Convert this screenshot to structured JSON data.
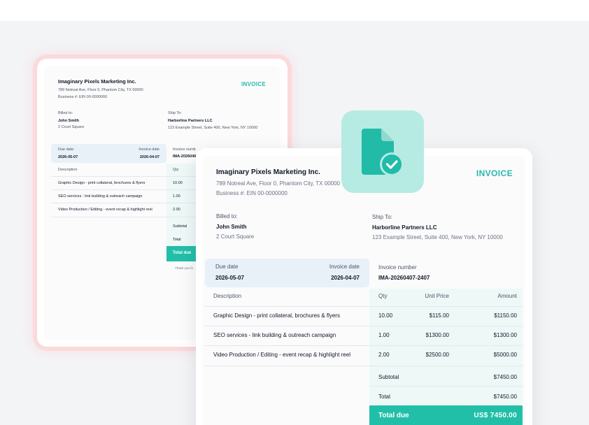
{
  "back_invoice": {
    "company": "Imaginary Pixels Marketing Inc.",
    "address": "789 Notreal Ave, Floor 0, Phantom City, TX 00000",
    "business_number": "Business #: EIN 00-0000000",
    "title": "INVOICE",
    "billed_to_label": "Billed to:",
    "billed_to_name": "John Smith",
    "billed_to_address": "2 Court Square",
    "ship_to_label": "Ship To:",
    "ship_to_name": "Harborline Partners LLC",
    "ship_to_address": "123 Example Street, Suite 400, New York, NY 10000",
    "due_date_label": "Due date",
    "due_date": "2026-05-07",
    "invoice_date_label": "Invoice date",
    "invoice_date": "2026-04-07",
    "invoice_number_label": "Invoice numb",
    "invoice_number": "IMA-2026040",
    "header_description": "Description",
    "header_qty": "Qty",
    "rows": [
      {
        "description": "Graphic Design - print collateral, brochures & flyers",
        "qty": "10.00"
      },
      {
        "description": "SEO services - link building & outreach campaign",
        "qty": "1.00"
      },
      {
        "description": "Video Production / Editing - event recap & highlight reel",
        "qty": "2.00"
      }
    ],
    "subtotal_label": "Subtotal",
    "total_label": "Total",
    "total_due_label": "Total due",
    "thanks": "Thank you fo"
  },
  "front_invoice": {
    "company": "Imaginary Pixels Marketing Inc.",
    "address": "789 Notreal Ave, Floor 0, Phantom City, TX 00000",
    "business_number": "Business #: EIN 00-0000000",
    "title": "INVOICE",
    "billed_to_label": "Billed to:",
    "billed_to_name": "John Smith",
    "billed_to_address": "2 Court Square",
    "ship_to_label": "Ship To:",
    "ship_to_name": "Harborline Partners LLC",
    "ship_to_address": "123 Example Street, Suite 400, New York, NY 10000",
    "due_date_label": "Due date",
    "due_date": "2026-05-07",
    "invoice_date_label": "Invoice date",
    "invoice_date": "2026-04-07",
    "invoice_number_label": "Invoice number",
    "invoice_number": "IMA-20260407-2407",
    "headers": {
      "description": "Description",
      "qty": "Qty",
      "unit_price": "Unit Price",
      "amount": "Amount"
    },
    "rows": [
      {
        "description": "Graphic Design - print collateral, brochures & flyers",
        "qty": "10.00",
        "unit_price": "$115.00",
        "amount": "$1150.00"
      },
      {
        "description": "SEO services - link building & outreach campaign",
        "qty": "1.00",
        "unit_price": "$1300.00",
        "amount": "$1300.00"
      },
      {
        "description": "Video Production / Editing - event recap & highlight reel",
        "qty": "2.00",
        "unit_price": "$2500.00",
        "amount": "$5000.00"
      }
    ],
    "subtotal_label": "Subtotal",
    "subtotal": "$7450.00",
    "total_label": "Total",
    "total": "$7450.00",
    "total_due_label": "Total due",
    "total_due": "US$ 7450.00"
  },
  "icon": "document-check-icon",
  "colors": {
    "accent": "#27b9a9",
    "total_due_bar": "#22bfa8",
    "icon_tile": "#b5ebe3",
    "back_card_glow": "#ffcdcd",
    "date_panel": "#e8f0f8"
  }
}
